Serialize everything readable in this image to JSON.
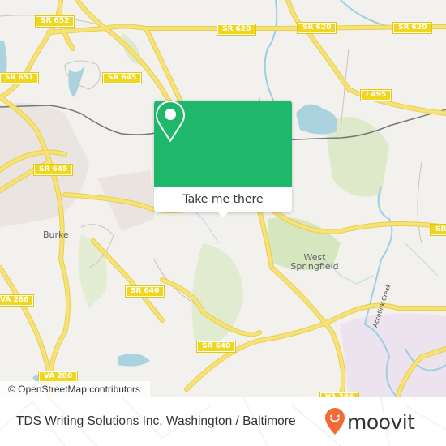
{
  "map": {
    "attribution": "© OpenStreetMap contributors",
    "road_shields": [
      {
        "id": "sr652",
        "label": "SR 652"
      },
      {
        "id": "sr620a",
        "label": "SR 620"
      },
      {
        "id": "sr620b",
        "label": "SR 620"
      },
      {
        "id": "sr620c",
        "label": "SR 620"
      },
      {
        "id": "sr651",
        "label": "SR 651"
      },
      {
        "id": "sr645a",
        "label": "SR 645"
      },
      {
        "id": "i495",
        "label": "I 495"
      },
      {
        "id": "sr645b",
        "label": "SR 645"
      },
      {
        "id": "va286a",
        "label": "VA 286"
      },
      {
        "id": "sr640a",
        "label": "SR 640"
      },
      {
        "id": "sr640b",
        "label": "SR 640"
      },
      {
        "id": "va286b",
        "label": "VA 286"
      },
      {
        "id": "va286c",
        "label": "VA 286"
      },
      {
        "id": "srright",
        "label": "SR"
      }
    ],
    "places": {
      "burke": "Burke",
      "west_springfield_line1": "West",
      "west_springfield_line2": "Springfield",
      "creek": "Accotink Creek"
    },
    "popup": {
      "icon": "map-pin-icon",
      "button_label": "Take me there",
      "color": "#1fb86a"
    }
  },
  "footer": {
    "title": "TDS Writing Solutions Inc, Washington / Baltimore",
    "logo_text": "moovit",
    "logo_color": "#f26b36"
  }
}
